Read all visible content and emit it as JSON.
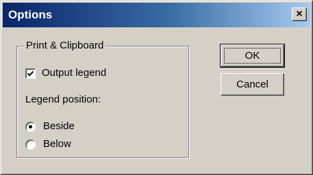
{
  "window": {
    "title": "Options",
    "close_glyph": "×",
    "colors": {
      "titlebar_start": "#0a246a",
      "titlebar_end": "#a6caf0",
      "face": "#d4d0c8"
    }
  },
  "group": {
    "label": "Print & Clipboard",
    "output_legend": {
      "label": "Output legend",
      "checked": true
    },
    "legend_position_label": "Legend position:",
    "options": [
      {
        "label": "Beside",
        "selected": true
      },
      {
        "label": "Below",
        "selected": false
      }
    ]
  },
  "buttons": {
    "ok_label": "OK",
    "cancel_label": "Cancel"
  },
  "icons": {
    "close": "close-icon",
    "check": "checkmark-icon"
  }
}
